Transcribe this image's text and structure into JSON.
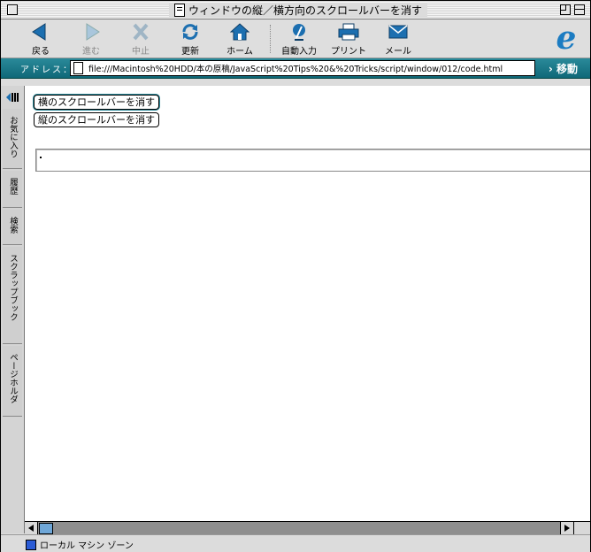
{
  "window": {
    "title": "ウィンドウの縦／横方向のスクロールバーを消す"
  },
  "toolbar": {
    "back": "戻る",
    "forward": "進む",
    "stop": "中止",
    "refresh": "更新",
    "home": "ホーム",
    "autofill": "自動入力",
    "print": "プリント",
    "mail": "メール"
  },
  "address": {
    "label": "アドレス：",
    "url": "file:///Macintosh%20HDD/本の原稿/JavaScript%20Tips%20&%20Tricks/script/window/012/code.html",
    "go": "移動"
  },
  "explorer_tabs": [
    "お気に入り",
    "履歴",
    "検索",
    "スクラップブック",
    "ページホルダ"
  ],
  "page": {
    "button_horizontal": "横のスクロールバーを消す",
    "button_vertical": "縦のスクロールバーを消す",
    "output_value": "."
  },
  "status": {
    "zone": "ローカル マシン ゾーン"
  },
  "colors": {
    "accent": "#1a7888",
    "scroll_thumb": "#6fa7d8"
  }
}
